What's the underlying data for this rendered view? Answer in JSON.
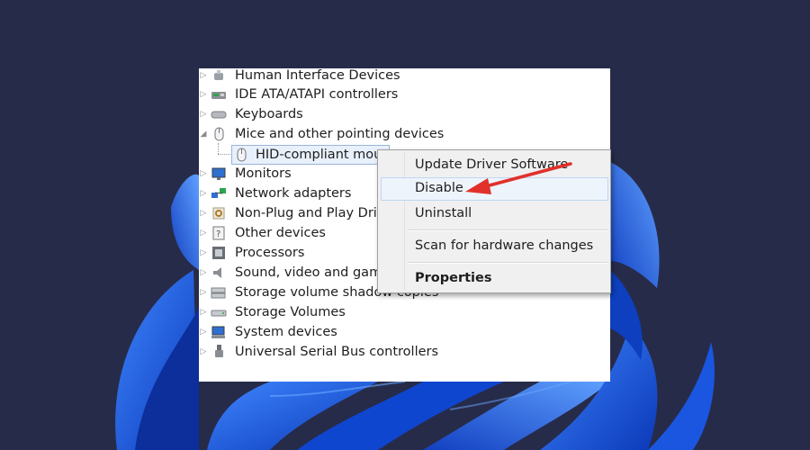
{
  "device_tree": {
    "items": [
      {
        "label": "Human Interface Devices",
        "icon": "hid-icon"
      },
      {
        "label": "IDE ATA/ATAPI controllers",
        "icon": "ide-controller-icon"
      },
      {
        "label": "Keyboards",
        "icon": "keyboard-icon"
      },
      {
        "label": "Mice and other pointing devices",
        "icon": "mouse-icon",
        "expanded": true
      },
      {
        "label": "HID-compliant mouse",
        "icon": "mouse-icon",
        "child": true,
        "selected": true
      },
      {
        "label": "Monitors",
        "icon": "monitor-icon"
      },
      {
        "label": "Network adapters",
        "icon": "network-icon"
      },
      {
        "label": "Non-Plug and Play Drivers",
        "icon": "gear-icon"
      },
      {
        "label": "Other devices",
        "icon": "unknown-device-icon"
      },
      {
        "label": "Processors",
        "icon": "processor-icon"
      },
      {
        "label": "Sound, video and game controllers",
        "icon": "speaker-icon"
      },
      {
        "label": "Storage volume shadow copies",
        "icon": "storage-icon"
      },
      {
        "label": "Storage Volumes",
        "icon": "drive-icon"
      },
      {
        "label": "System devices",
        "icon": "computer-icon"
      },
      {
        "label": "Universal Serial Bus controllers",
        "icon": "usb-icon"
      }
    ]
  },
  "context_menu": {
    "items": [
      {
        "label": "Update Driver Software"
      },
      {
        "label": "Disable",
        "highlighted": true
      },
      {
        "label": "Uninstall"
      },
      {
        "label": "Scan for hardware changes"
      },
      {
        "label": "Properties",
        "bold": true
      }
    ]
  },
  "colors": {
    "background": "#272b4a",
    "wallpaper_blue": "#1d5fe0",
    "selection_border": "#99b4d9",
    "menu_background": "#f0f0f0",
    "annotation_arrow": "#e0312b"
  }
}
